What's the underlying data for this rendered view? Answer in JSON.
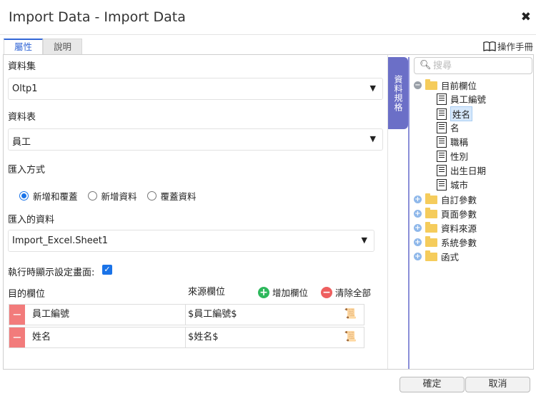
{
  "window": {
    "title": "Import Data - Import Data"
  },
  "tabs": [
    {
      "label": "屬性"
    },
    {
      "label": "說明"
    }
  ],
  "manual_label": "操作手冊",
  "form": {
    "dataset_label": "資料集",
    "dataset_value": "Oltp1",
    "table_label": "資料表",
    "table_value": "員工",
    "mode_label": "匯入方式",
    "modes": [
      {
        "label": "新增和覆蓋"
      },
      {
        "label": "新增資料"
      },
      {
        "label": "覆蓋資料"
      }
    ],
    "selected_mode": "新增和覆蓋",
    "import_label": "匯入的資料",
    "import_value": "Import_Excel.Sheet1",
    "show_settings_label": "執行時顯示設定畫面:",
    "show_settings_checked": true
  },
  "mapping": {
    "dest_header": "目的欄位",
    "source_header": "來源欄位",
    "add_label": "增加欄位",
    "clear_label": "清除全部",
    "rows": [
      {
        "dest": "員工編號",
        "source": "$員工編號$"
      },
      {
        "dest": "姓名",
        "source": "$姓名$"
      }
    ]
  },
  "spec_tab_label": "資料規格",
  "tree": {
    "search_placeholder": "搜尋",
    "current_fields": {
      "label": "目前欄位",
      "children": [
        {
          "label": "員工編號"
        },
        {
          "label": "姓名"
        },
        {
          "label": "名"
        },
        {
          "label": "職稱"
        },
        {
          "label": "性別"
        },
        {
          "label": "出生日期"
        },
        {
          "label": "城市"
        }
      ]
    },
    "selected_field": "姓名",
    "folders": [
      {
        "label": "自訂參數"
      },
      {
        "label": "頁面參數"
      },
      {
        "label": "資料來源"
      },
      {
        "label": "系統參數"
      },
      {
        "label": "函式"
      }
    ]
  },
  "buttons": {
    "ok": "確定",
    "cancel": "取消"
  }
}
